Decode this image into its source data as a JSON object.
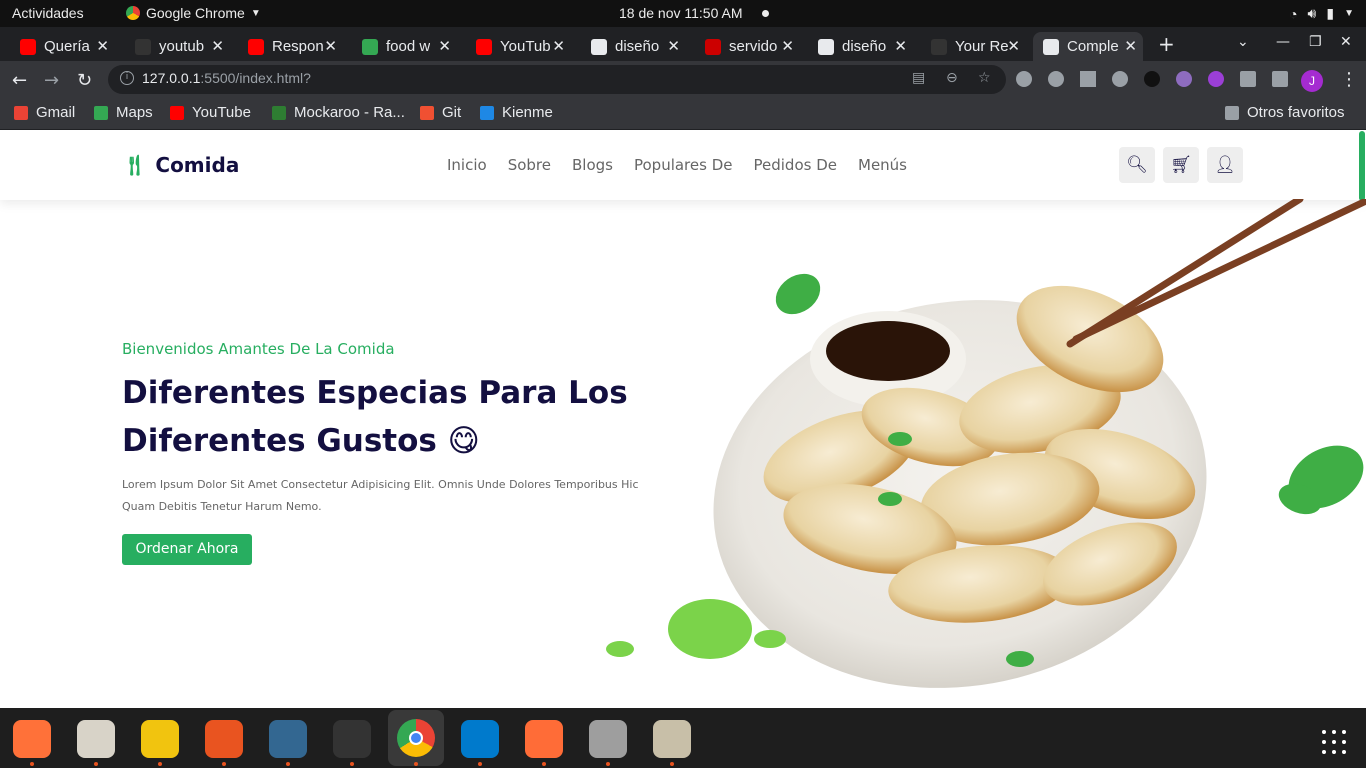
{
  "system": {
    "activities": "Actividades",
    "app_name": "Google Chrome",
    "clock": "18 de nov  11:50 AM"
  },
  "tabs": [
    {
      "title": "Quería",
      "icon": "youtube-icon",
      "color": "#ff0000"
    },
    {
      "title": "youtub",
      "icon": "github-icon",
      "color": "#333333"
    },
    {
      "title": "Respon",
      "icon": "youtube-icon",
      "color": "#ff0000"
    },
    {
      "title": "food w",
      "icon": "google-drive-icon",
      "color": "#34a853"
    },
    {
      "title": "YouTub",
      "icon": "youtube-icon",
      "color": "#ff0000"
    },
    {
      "title": "diseño",
      "icon": "globe-icon",
      "color": "#e8eaed"
    },
    {
      "title": "servido",
      "icon": "n-icon",
      "color": "#cc0000"
    },
    {
      "title": "diseño",
      "icon": "globe-icon",
      "color": "#e8eaed"
    },
    {
      "title": "Your Re",
      "icon": "github-icon",
      "color": "#333333"
    },
    {
      "title": "Comple",
      "icon": "globe-icon",
      "color": "#e8eaed"
    }
  ],
  "address_bar": {
    "host": "127.0.0.1",
    "path": ":5500/index.html?"
  },
  "profile_initial": "J",
  "bookmarks": [
    {
      "label": "Gmail",
      "icon": "gmail-icon",
      "color": "#ea4335"
    },
    {
      "label": "Maps",
      "icon": "maps-icon",
      "color": "#34a853"
    },
    {
      "label": "YouTube",
      "icon": "youtube-icon",
      "color": "#ff0000"
    },
    {
      "label": "Mockaroo - Ra...",
      "icon": "mockaroo-icon",
      "color": "#2e7d32"
    },
    {
      "label": "Git",
      "icon": "git-icon",
      "color": "#f05032"
    },
    {
      "label": "Kienme",
      "icon": "kienme-icon",
      "color": "#1e88e5"
    }
  ],
  "other_bookmarks": "Otros favoritos",
  "site": {
    "logo": "Comida",
    "menu": [
      "Inicio",
      "Sobre",
      "Blogs",
      "Populares De",
      "Pedidos De",
      "Menús"
    ],
    "hero_subtitle": "Bienvenidos Amantes De La Comida",
    "hero_title": "Diferentes Especias Para Los Diferentes Gustos 😋",
    "hero_description": "Lorem Ipsum Dolor Sit Amet Consectetur Adipisicing Elit. Omnis Unde Dolores Temporibus Hic Quam Debitis Tenetur Harum Nemo.",
    "cta": "Ordenar Ahora",
    "accent_color": "#27ae60",
    "title_color": "#130f40"
  },
  "dock": [
    {
      "icon": "firefox-icon",
      "color": "#ff7139"
    },
    {
      "icon": "files-icon",
      "color": "#d8d3c8"
    },
    {
      "icon": "rhythmbox-icon",
      "color": "#f1c40f"
    },
    {
      "icon": "software-center-icon",
      "color": "#e95420"
    },
    {
      "icon": "pgadmin-icon",
      "color": "#336791"
    },
    {
      "icon": "terminal-icon",
      "color": "#333333"
    },
    {
      "icon": "chrome-icon",
      "color": "#4285f4"
    },
    {
      "icon": "vscode-icon",
      "color": "#007acc"
    },
    {
      "icon": "postman-icon",
      "color": "#ff6c37"
    },
    {
      "icon": "settings-icon",
      "color": "#9e9e9e"
    },
    {
      "icon": "archive-icon",
      "color": "#c8bfa8"
    }
  ]
}
